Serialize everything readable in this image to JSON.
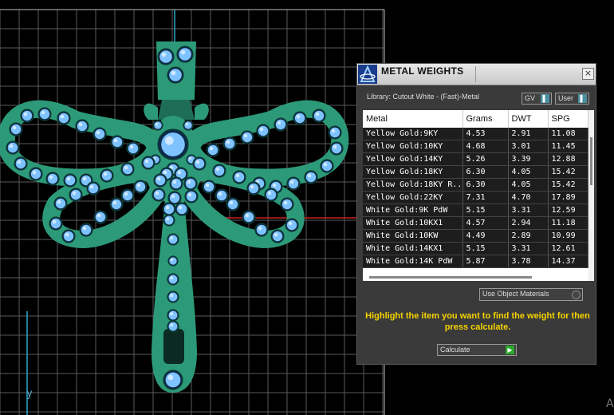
{
  "viewport": {
    "axis_label": "y",
    "corner_glyph": "A",
    "colors": {
      "background": "#000000",
      "grid": "#5a5a5a",
      "body": "#2c9a78",
      "gem": "#7ec3ff",
      "axis_red": "#c62020",
      "axis_cyan": "#2fa8c8"
    }
  },
  "panel": {
    "title": "METAL WEIGHTS",
    "close_label": "×",
    "icon": "app-logo-icon",
    "library_label": "Library: Cutout White - (Fast)-Metal",
    "unit_selects": [
      {
        "value": "GV",
        "button": "▌"
      },
      {
        "value": "User",
        "button": "▌"
      }
    ],
    "table": {
      "headers": [
        "Metal",
        "Grams",
        "DWT",
        "SPG"
      ],
      "rows": [
        [
          "Yellow Gold:9KY",
          "4.53",
          "2.91",
          "11.08"
        ],
        [
          "Yellow Gold:10KY",
          "4.68",
          "3.01",
          "11.45"
        ],
        [
          "Yellow Gold:14KY",
          "5.26",
          "3.39",
          "12.88"
        ],
        [
          "Yellow Gold:18KY",
          "6.30",
          "4.05",
          "15.42"
        ],
        [
          "Yellow Gold:18KY R...",
          "6.30",
          "4.05",
          "15.42"
        ],
        [
          "Yellow Gold:22KY",
          "7.31",
          "4.70",
          "17.89"
        ],
        [
          "White Gold:9K PdW",
          "5.15",
          "3.31",
          "12.59"
        ],
        [
          "White Gold:10KX1",
          "4.57",
          "2.94",
          "11.18"
        ],
        [
          "White Gold:10KW",
          "4.49",
          "2.89",
          "10.99"
        ],
        [
          "White Gold:14KX1",
          "5.15",
          "3.31",
          "12.61"
        ],
        [
          "White Gold:14K PdW",
          "5.87",
          "3.78",
          "14.37"
        ]
      ]
    },
    "use_object_label": "Use Object Materials",
    "instructions": "Highlight the item you want to find the weight for then press calculate.",
    "calculate_label": "Calculate",
    "calculate_button": "▶"
  }
}
